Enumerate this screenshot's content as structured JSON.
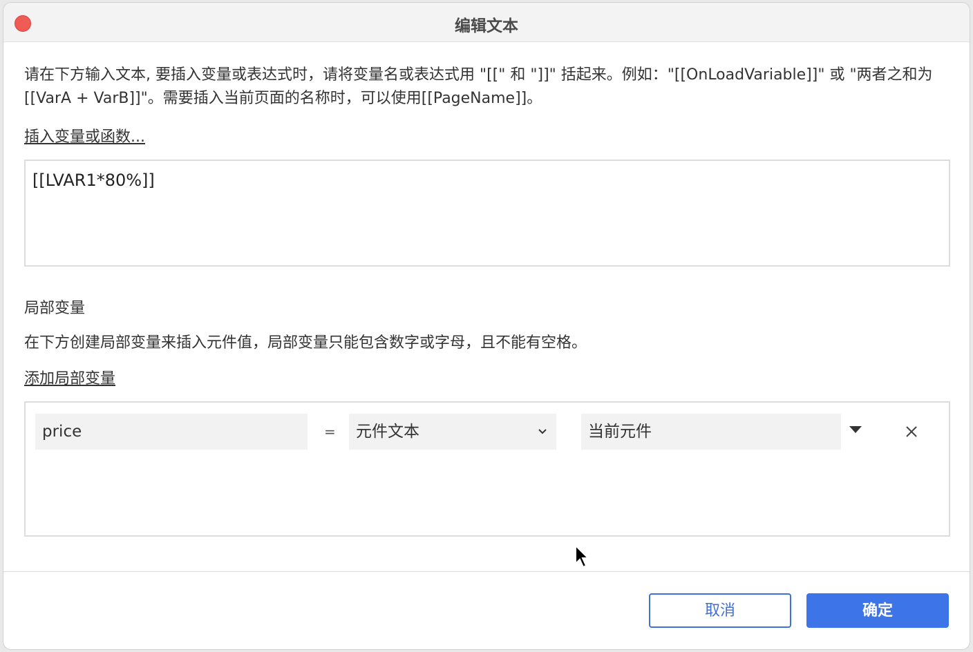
{
  "window": {
    "title": "编辑文本"
  },
  "main": {
    "description": "请在下方输入文本, 要插入变量或表达式时，请将变量名或表达式用 \"[[\" 和 \"]]\" 括起来。例如：\"[[OnLoadVariable]]\" 或 \"两者之和为 [[VarA + VarB]]\"。需要插入当前页面的名称时，可以使用[[PageName]]。",
    "insert_link": "插入变量或函数...",
    "text_value": "[[LVAR1*80%]]"
  },
  "local_vars": {
    "title": "局部变量",
    "description": "在下方创建局部变量来插入元件值，局部变量只能包含数字或字母，且不能有空格。",
    "add_link": "添加局部变量",
    "rows": [
      {
        "name": "price",
        "equals": "=",
        "type": "元件文本",
        "target": "当前元件"
      }
    ]
  },
  "footer": {
    "cancel_label": "取消",
    "ok_label": "确定"
  },
  "icons": {
    "close": "close-dot",
    "dropdown": "chevron-down-icon",
    "target_dropdown": "caret-down-icon",
    "remove": "close-icon",
    "cursor": "mouse-pointer-icon"
  },
  "colors": {
    "accent": "#3d74e8",
    "close_dot": "#ee5c55"
  }
}
